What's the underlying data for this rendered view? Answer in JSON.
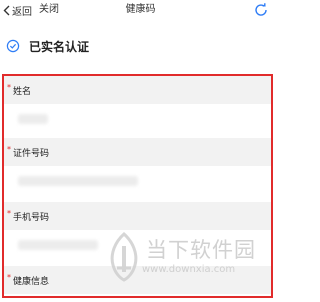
{
  "navbar": {
    "back_label": "返回",
    "close_label": "关闭",
    "title": "健康码",
    "refresh_icon": "refresh-icon"
  },
  "verified": {
    "label": "已实名认证",
    "icon": "check-circle-icon"
  },
  "form": {
    "required_mark": "*",
    "fields": [
      {
        "label": "姓名"
      },
      {
        "label": "证件号码"
      },
      {
        "label": "手机号码"
      },
      {
        "label": "健康信息"
      }
    ]
  },
  "watermark": {
    "title": "当下软件园",
    "url": "www.downxia.com"
  },
  "colors": {
    "accent_blue": "#2f7df6",
    "highlight_red": "#e12b2b",
    "section_gray": "#f2f2f2",
    "watermark_gray": "#c9c9c9"
  }
}
